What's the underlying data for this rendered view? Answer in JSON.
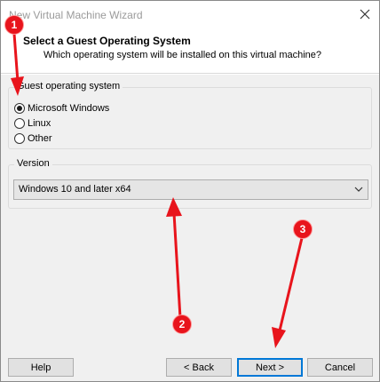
{
  "window": {
    "title": "New Virtual Machine Wizard",
    "close_icon": "close-icon"
  },
  "header": {
    "title": "Select a Guest Operating System",
    "subtitle": "Which operating system will be installed on this virtual machine?"
  },
  "guest_os": {
    "legend": "Guest operating system",
    "options": [
      {
        "label": "Microsoft Windows",
        "selected": true
      },
      {
        "label": "Linux",
        "selected": false
      },
      {
        "label": "Other",
        "selected": false
      }
    ]
  },
  "version": {
    "legend": "Version",
    "selected": "Windows 10 and later x64"
  },
  "footer": {
    "help": "Help",
    "back": "< Back",
    "next": "Next >",
    "cancel": "Cancel"
  },
  "annotations": {
    "badges": [
      "1",
      "2",
      "3"
    ],
    "color": "#e8141c"
  }
}
